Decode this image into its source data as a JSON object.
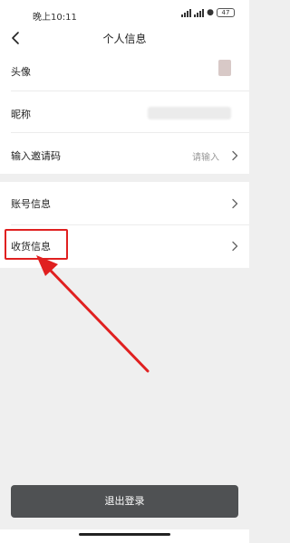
{
  "status_bar": {
    "time": "晚上10:11",
    "battery": "47",
    "signal_icon": "signal-icon",
    "wifi_icon": "wifi-icon",
    "battery_icon": "battery-icon"
  },
  "nav": {
    "title": "个人信息",
    "back_icon": "back-chevron-icon"
  },
  "profile_rows": [
    {
      "label": "头像"
    },
    {
      "label": "昵称"
    },
    {
      "label": "输入邀请码",
      "placeholder": "请输入"
    }
  ],
  "account_rows": [
    {
      "label": "账号信息"
    },
    {
      "label": "收货信息"
    }
  ],
  "logout": {
    "label": "退出登录"
  },
  "annotation": {
    "color": "#e02020"
  },
  "colors": {
    "background": "#efefef",
    "button": "#4f5153"
  }
}
